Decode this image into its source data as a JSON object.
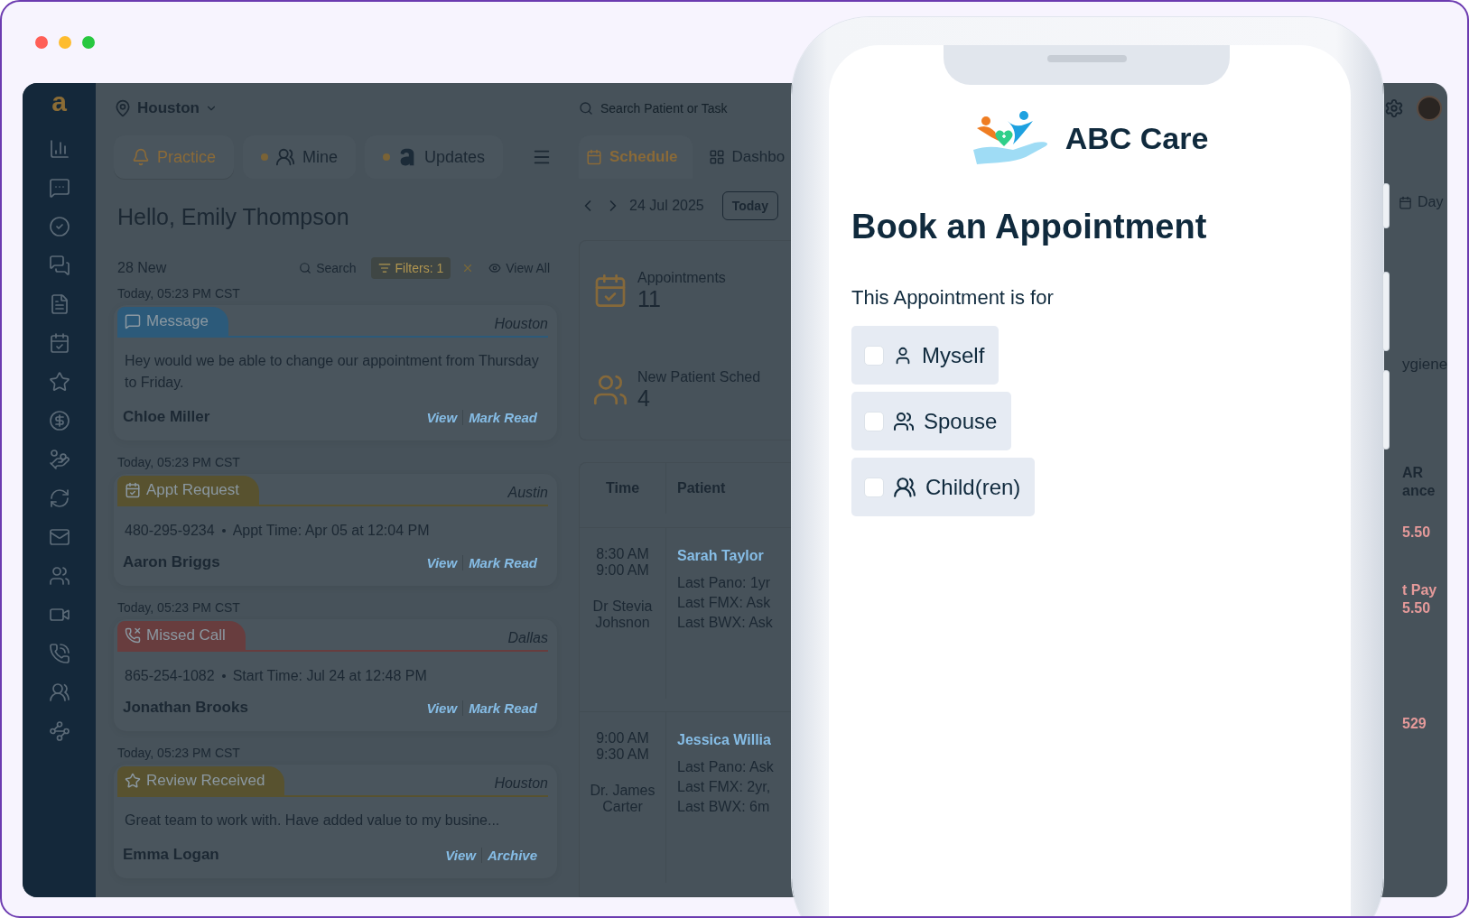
{
  "app": {
    "logo": "a",
    "location": "Houston",
    "search": {
      "placeholder": "Search Patient or Task"
    },
    "panel_tabs": [
      {
        "kind": "practice",
        "label": "Practice",
        "selected": true,
        "dot": false
      },
      {
        "kind": "mine",
        "label": "Mine",
        "selected": false,
        "dot": true
      },
      {
        "kind": "updates",
        "label": "Updates",
        "selected": false,
        "dot": true
      }
    ],
    "greeting": "Hello, Emily Thompson",
    "new_count": "28 New",
    "search_label": "Search",
    "filter_label": "Filters: 1",
    "view_all": "View All",
    "feed": [
      {
        "time": "Today, 05:23 PM CST",
        "kind": "message",
        "tag": "Message",
        "color": "#2c5a7a",
        "location": "Houston",
        "body": "Hey would we be able to change our appointment from Thursday to Friday.",
        "name": "Chloe Miller",
        "actions": [
          "View",
          "Mark Read"
        ]
      },
      {
        "time": "Today, 05:23 PM CST",
        "kind": "appointment",
        "tag": "Appt Request",
        "color": "#58522f",
        "location": "Austin",
        "phone": "480-295-9234",
        "detail": "Appt Time: Apr 05 at 12:04 PM",
        "name": "Aaron Briggs",
        "actions": [
          "View",
          "Mark Read"
        ]
      },
      {
        "time": "Today, 05:23 PM CST",
        "kind": "missed_call",
        "tag": "Missed Call",
        "color": "#683d3e",
        "location": "Dallas",
        "phone": "865-254-1082",
        "detail": "Start Time: Jul 24 at 12:48 PM",
        "name": "Jonathan Brooks",
        "actions": [
          "View",
          "Mark Read"
        ]
      },
      {
        "time": "Today, 05:23 PM CST",
        "kind": "review",
        "tag": "Review Received",
        "color": "#58522f",
        "location": "Houston",
        "body": "Great team to work with. Have added value to my busine...",
        "name": "Emma Logan",
        "actions": [
          "View",
          "Archive"
        ]
      }
    ]
  },
  "schedule": {
    "tabs": [
      {
        "kind": "schedule",
        "label": "Schedule",
        "selected": true
      },
      {
        "kind": "dashboard",
        "label": "Dashbo",
        "selected": false
      }
    ],
    "date": "24 Jul 2025",
    "today": "Today",
    "stats": [
      {
        "kind": "appointments",
        "label": "Appointments",
        "value": "11"
      },
      {
        "kind": "new_patients",
        "label": "New Patient Sched",
        "value": "4"
      }
    ],
    "columns": [
      "Time",
      "Patient"
    ],
    "rows": [
      {
        "start": "8:30 AM",
        "end": "9:00 AM",
        "provider": "Dr Stevia Johsnon",
        "patient": "Sarah Taylor",
        "notes": [
          "Last Pano: 1yr",
          "Last FMX: Ask",
          "Last BWX: Ask"
        ]
      },
      {
        "start": "9:00 AM",
        "end": "9:30 AM",
        "provider": "Dr. James Carter",
        "patient": "Jessica Willia",
        "notes": [
          "Last Pano: Ask",
          "Last FMX: 2yr,",
          "Last BWX: 6m"
        ]
      }
    ]
  },
  "right_strip": {
    "view_mode": "Day",
    "stat_label": "ygiene",
    "heading_lines": [
      "AR",
      "ance"
    ],
    "amounts": [
      {
        "lines": [
          "5.50"
        ]
      },
      {
        "lines": [
          "t Pay",
          "5.50"
        ]
      },
      {
        "lines": [
          "529"
        ]
      }
    ]
  },
  "phone": {
    "brand": "ABC Care",
    "title": "Book an Appointment",
    "question": "This Appointment is for",
    "options": [
      {
        "kind": "self",
        "label": "Myself",
        "checked": false
      },
      {
        "kind": "spouse",
        "label": "Spouse",
        "checked": false
      },
      {
        "kind": "children",
        "label": "Child(ren)",
        "checked": false
      }
    ]
  }
}
